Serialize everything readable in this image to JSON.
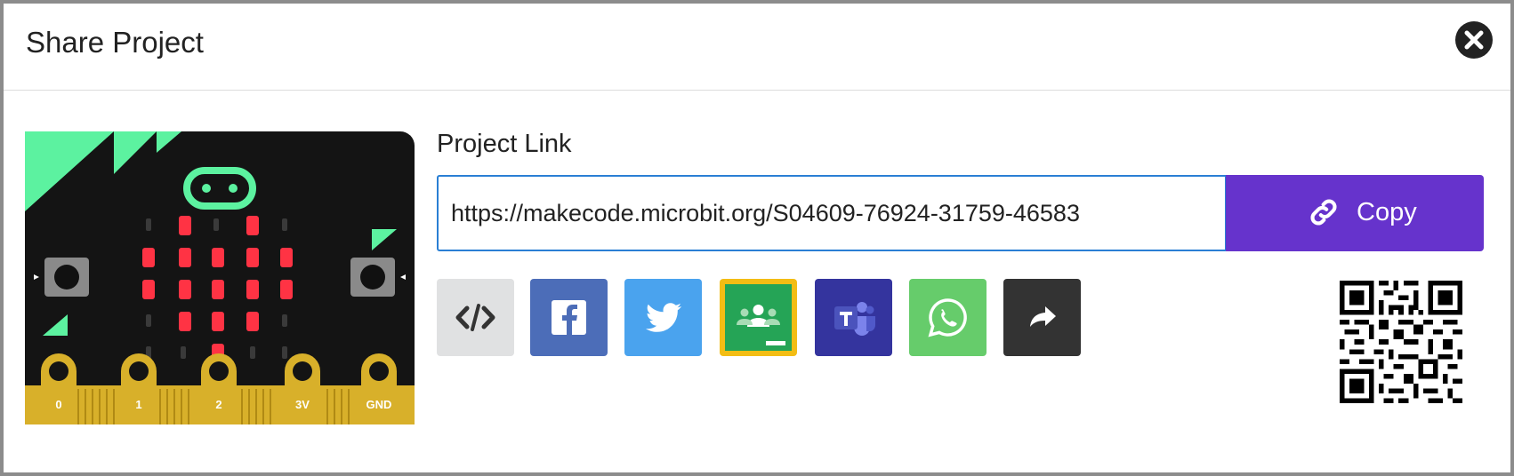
{
  "dialog": {
    "title": "Share Project"
  },
  "link": {
    "label": "Project Link",
    "url": "https://makecode.microbit.org/S04609-76924-31759-46583",
    "copy_label": "Copy"
  },
  "device": {
    "pins": [
      "0",
      "1",
      "2",
      "3V",
      "GND"
    ],
    "buttons": [
      "A",
      "B"
    ]
  },
  "share_buttons": [
    {
      "name": "embed",
      "icon": "code-icon",
      "color": "#e0e1e2"
    },
    {
      "name": "facebook",
      "icon": "facebook-icon",
      "color": "#3b5998"
    },
    {
      "name": "twitter",
      "icon": "twitter-icon",
      "color": "#55acee"
    },
    {
      "name": "google-classroom",
      "icon": "google-classroom-icon",
      "color": "#25a456"
    },
    {
      "name": "microsoft-teams",
      "icon": "teams-icon",
      "color": "#464eb8"
    },
    {
      "name": "whatsapp",
      "icon": "whatsapp-icon",
      "color": "#25d366"
    },
    {
      "name": "more-share",
      "icon": "share-arrow-icon",
      "color": "#333333"
    }
  ],
  "colors": {
    "accent": "#6633cc",
    "input_border": "#2a7fd4",
    "device_accent": "#00ff99",
    "led_on": "#ff3344"
  }
}
